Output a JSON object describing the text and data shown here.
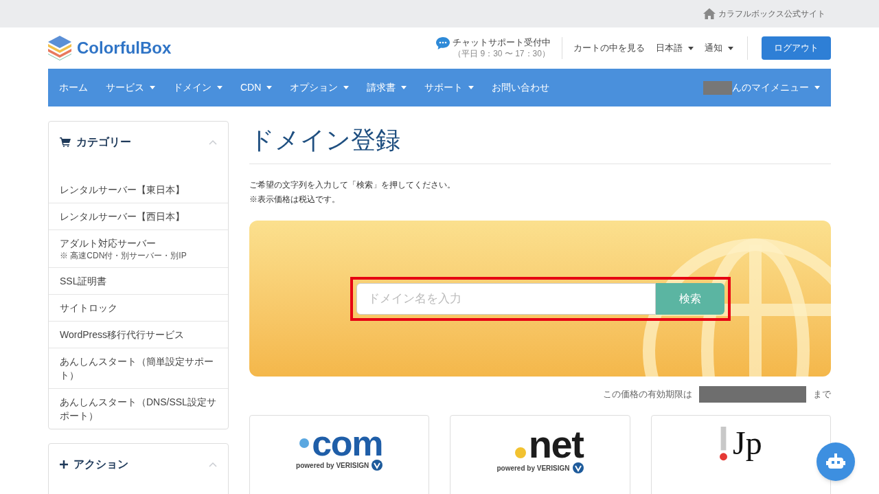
{
  "top_bar": {
    "link": "カラフルボックス公式サイト"
  },
  "header": {
    "logo": "ColorfulBox",
    "chat": {
      "title": "チャットサポート受付中",
      "hours": "（平日 9：30 〜 17：30）"
    },
    "links": [
      {
        "label": "カートの中を見る",
        "dropdown": false
      },
      {
        "label": "日本語",
        "dropdown": true
      },
      {
        "label": "通知",
        "dropdown": true
      }
    ],
    "logout": "ログアウト"
  },
  "nav": {
    "items": [
      {
        "label": "ホーム",
        "dropdown": false
      },
      {
        "label": "サービス",
        "dropdown": true
      },
      {
        "label": "ドメイン",
        "dropdown": true
      },
      {
        "label": "CDN",
        "dropdown": true
      },
      {
        "label": "オプション",
        "dropdown": true
      },
      {
        "label": "請求書",
        "dropdown": true
      },
      {
        "label": "サポート",
        "dropdown": true
      },
      {
        "label": "お問い合わせ",
        "dropdown": false
      }
    ],
    "user_menu": {
      "label": "んのマイメニュー",
      "dropdown": true
    }
  },
  "sidebar": {
    "categories": {
      "title": "カテゴリー",
      "expanded": true,
      "items": [
        {
          "label": "レンタルサーバー【東日本】"
        },
        {
          "label": "レンタルサーバー【西日本】"
        },
        {
          "label": "アダルト対応サーバー",
          "note": "※ 高速CDN付・別サーバー・別IP"
        },
        {
          "label": "SSL証明書"
        },
        {
          "label": "サイトロック"
        },
        {
          "label": "WordPress移行代行サービス"
        },
        {
          "label": "あんしんスタート（簡単設定サポート）"
        },
        {
          "label": "あんしんスタート（DNS/SSL設定サポート）"
        }
      ]
    },
    "actions": {
      "title": "アクション",
      "expanded": true
    }
  },
  "main": {
    "title": "ドメイン登録",
    "description": [
      "ご希望の文字列を入力して「検索」を押してください。",
      "※表示価格は税込です。"
    ],
    "search": {
      "placeholder": "ドメイン名を入力",
      "button": "検索"
    },
    "validity": {
      "prefix": "この価格の有効期限は",
      "suffix": "まで"
    },
    "tlds": [
      {
        "kind": "com",
        "name": "com",
        "powered": "powered by VERISIGN"
      },
      {
        "kind": "net",
        "name": "net",
        "powered": "powered by VERISIGN"
      },
      {
        "kind": "jp",
        "name": "Jp"
      }
    ]
  }
}
